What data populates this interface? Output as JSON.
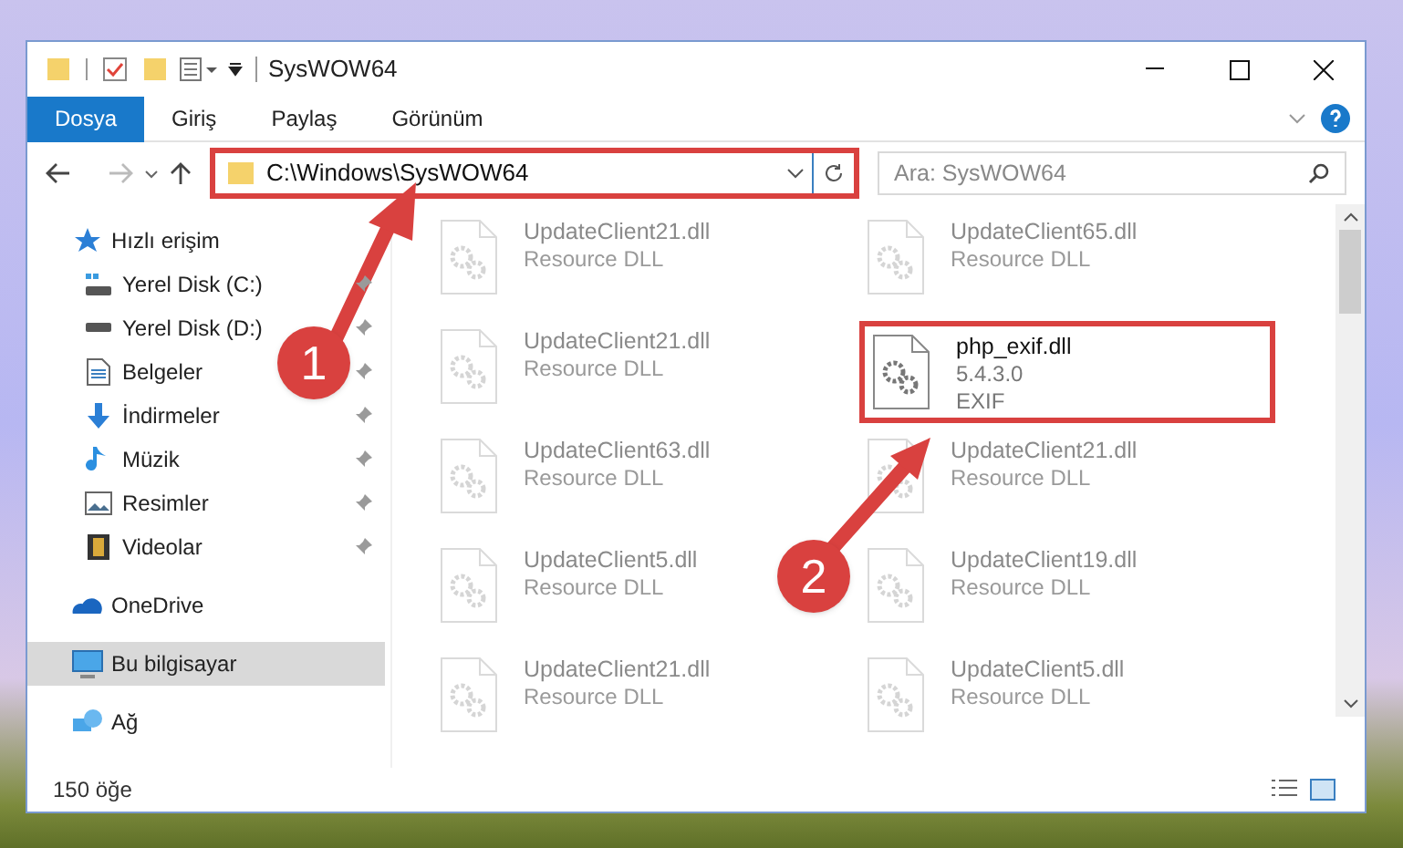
{
  "window": {
    "title": "SysWOW64"
  },
  "ribbon_tabs": [
    {
      "label": "Dosya",
      "selected": true
    },
    {
      "label": "Giriş",
      "selected": false
    },
    {
      "label": "Paylaş",
      "selected": false
    },
    {
      "label": "Görünüm",
      "selected": false
    }
  ],
  "address_bar": {
    "path": "C:\\Windows\\SysWOW64",
    "highlighted": true
  },
  "search": {
    "placeholder": "Ara: SysWOW64"
  },
  "sidebar": {
    "items": [
      {
        "label": "Hızlı erişim",
        "kind": "quick",
        "pinned": false,
        "selected": false,
        "children": [
          {
            "label": "Yerel Disk (C:)",
            "kind": "disk-c",
            "pinned": true,
            "selected": false
          },
          {
            "label": "Yerel Disk (D:)",
            "kind": "disk",
            "pinned": true,
            "selected": false
          },
          {
            "label": "Belgeler",
            "kind": "docs",
            "pinned": true,
            "selected": false
          },
          {
            "label": "İndirmeler",
            "kind": "download",
            "pinned": true,
            "selected": false
          },
          {
            "label": "Müzik",
            "kind": "music",
            "pinned": true,
            "selected": false
          },
          {
            "label": "Resimler",
            "kind": "pictures",
            "pinned": true,
            "selected": false
          },
          {
            "label": "Videolar",
            "kind": "videos",
            "pinned": true,
            "selected": false
          }
        ]
      },
      {
        "label": "OneDrive",
        "kind": "cloud",
        "pinned": false,
        "selected": false
      },
      {
        "label": "Bu bilgisayar",
        "kind": "pc",
        "pinned": false,
        "selected": true
      },
      {
        "label": "Ağ",
        "kind": "network",
        "pinned": false,
        "selected": false
      }
    ]
  },
  "files": [
    {
      "name": "UpdateClient21.dll",
      "detail": "Resource DLL",
      "blurred": true,
      "highlighted": false
    },
    {
      "name": "UpdateClient65.dll",
      "detail": "Resource DLL",
      "blurred": true,
      "highlighted": false
    },
    {
      "name": "UpdateClient21.dll",
      "detail": "Resource DLL",
      "blurred": true,
      "highlighted": false
    },
    {
      "name": "php_exif.dll",
      "version": "5.4.3.0",
      "detail": "EXIF",
      "blurred": false,
      "highlighted": true
    },
    {
      "name": "UpdateClient63.dll",
      "detail": "Resource DLL",
      "blurred": true,
      "highlighted": false
    },
    {
      "name": "UpdateClient21.dll",
      "detail": "Resource DLL",
      "blurred": true,
      "highlighted": false
    },
    {
      "name": "UpdateClient5.dll",
      "detail": "Resource DLL",
      "blurred": true,
      "highlighted": false
    },
    {
      "name": "UpdateClient19.dll",
      "detail": "Resource DLL",
      "blurred": true,
      "highlighted": false
    },
    {
      "name": "UpdateClient21.dll",
      "detail": "Resource DLL",
      "blurred": true,
      "highlighted": false
    },
    {
      "name": "UpdateClient5.dll",
      "detail": "Resource DLL",
      "blurred": true,
      "highlighted": false
    }
  ],
  "status_bar": {
    "count": "150 öğe"
  },
  "annotations": [
    {
      "number": "1"
    },
    {
      "number": "2"
    }
  ]
}
